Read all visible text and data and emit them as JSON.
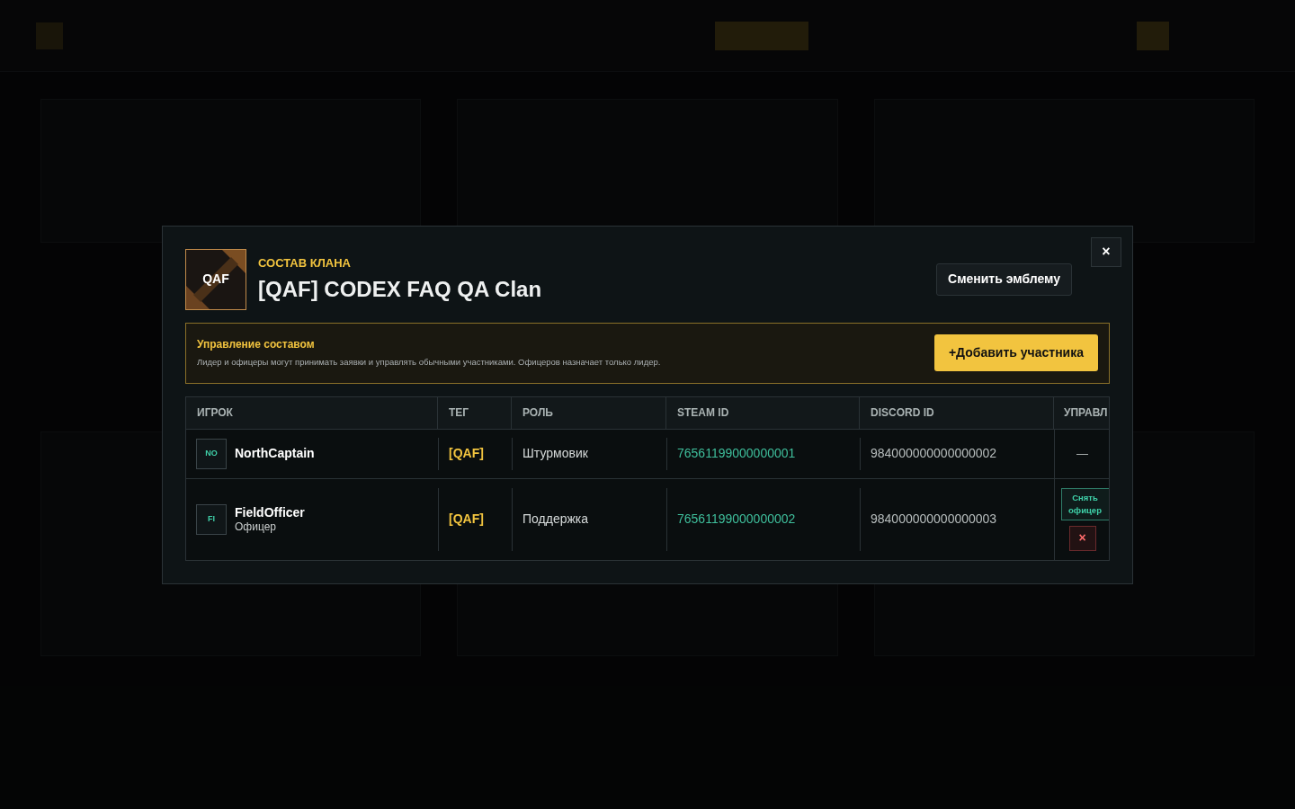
{
  "modal": {
    "eyebrow": "СОСТАВ КЛАНА",
    "title": "[QAF] CODEX FAQ QA Clan",
    "emblem": {
      "text": "QAF"
    },
    "change_emblem_button": "Сменить эмблему",
    "close_button": "×",
    "notice": {
      "title": "Управление составом",
      "text": "Лидер и офицеры могут принимать заявки и управлять обычными участниками. Офицеров назначает только лидер.",
      "button": "+Добавить участника"
    },
    "table": {
      "columns": [
        "ИГРОК",
        "ТЕГ",
        "РОЛЬ",
        "STEAM ID",
        "DISCORD ID",
        "УПРАВЛ"
      ],
      "rows": [
        {
          "initials": "NO",
          "name": "NorthCaptain",
          "tag": "[QAF]",
          "role": "Штурмовик",
          "steam_id": "76561199000000001",
          "discord_id": "984000000000000002",
          "actions": [
            {
              "kind": "none",
              "label": "—"
            }
          ]
        },
        {
          "initials": "FI",
          "name": "FieldOfficer",
          "rank": "Офицер",
          "tag": "[QAF]",
          "role": "Поддержка",
          "steam_id": "76561199000000002",
          "discord_id": "984000000000000003",
          "actions": [
            {
              "kind": "demote",
              "label": "Снять офицер"
            },
            {
              "kind": "remove",
              "label": "×"
            }
          ]
        }
      ]
    }
  }
}
